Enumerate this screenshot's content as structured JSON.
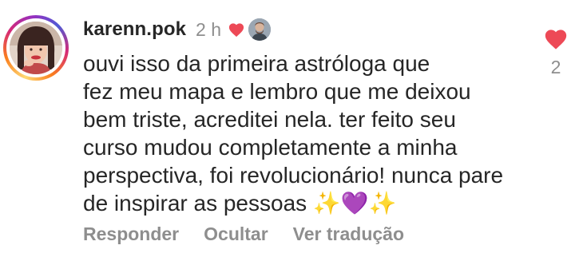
{
  "comment": {
    "username": "karenn.pok",
    "timestamp": "2 h",
    "author_liked_icon": "heart-icon",
    "text": "ouvi isso da primeira astróloga que\nfez meu mapa e lembro que me deixou\nbem triste, acreditei nela. ter feito seu\ncurso mudou completamente a minha\nperspectiva, foi revolucionário! nunca pare\nde inspirar as pessoas ✨💜✨",
    "like_count": "2",
    "actions": {
      "reply_label": "Responder",
      "hide_label": "Ocultar",
      "translate_label": "Ver tradução"
    }
  },
  "colors": {
    "heart": "#ed4956",
    "muted_text": "#8e8e8e",
    "text": "#262626"
  }
}
